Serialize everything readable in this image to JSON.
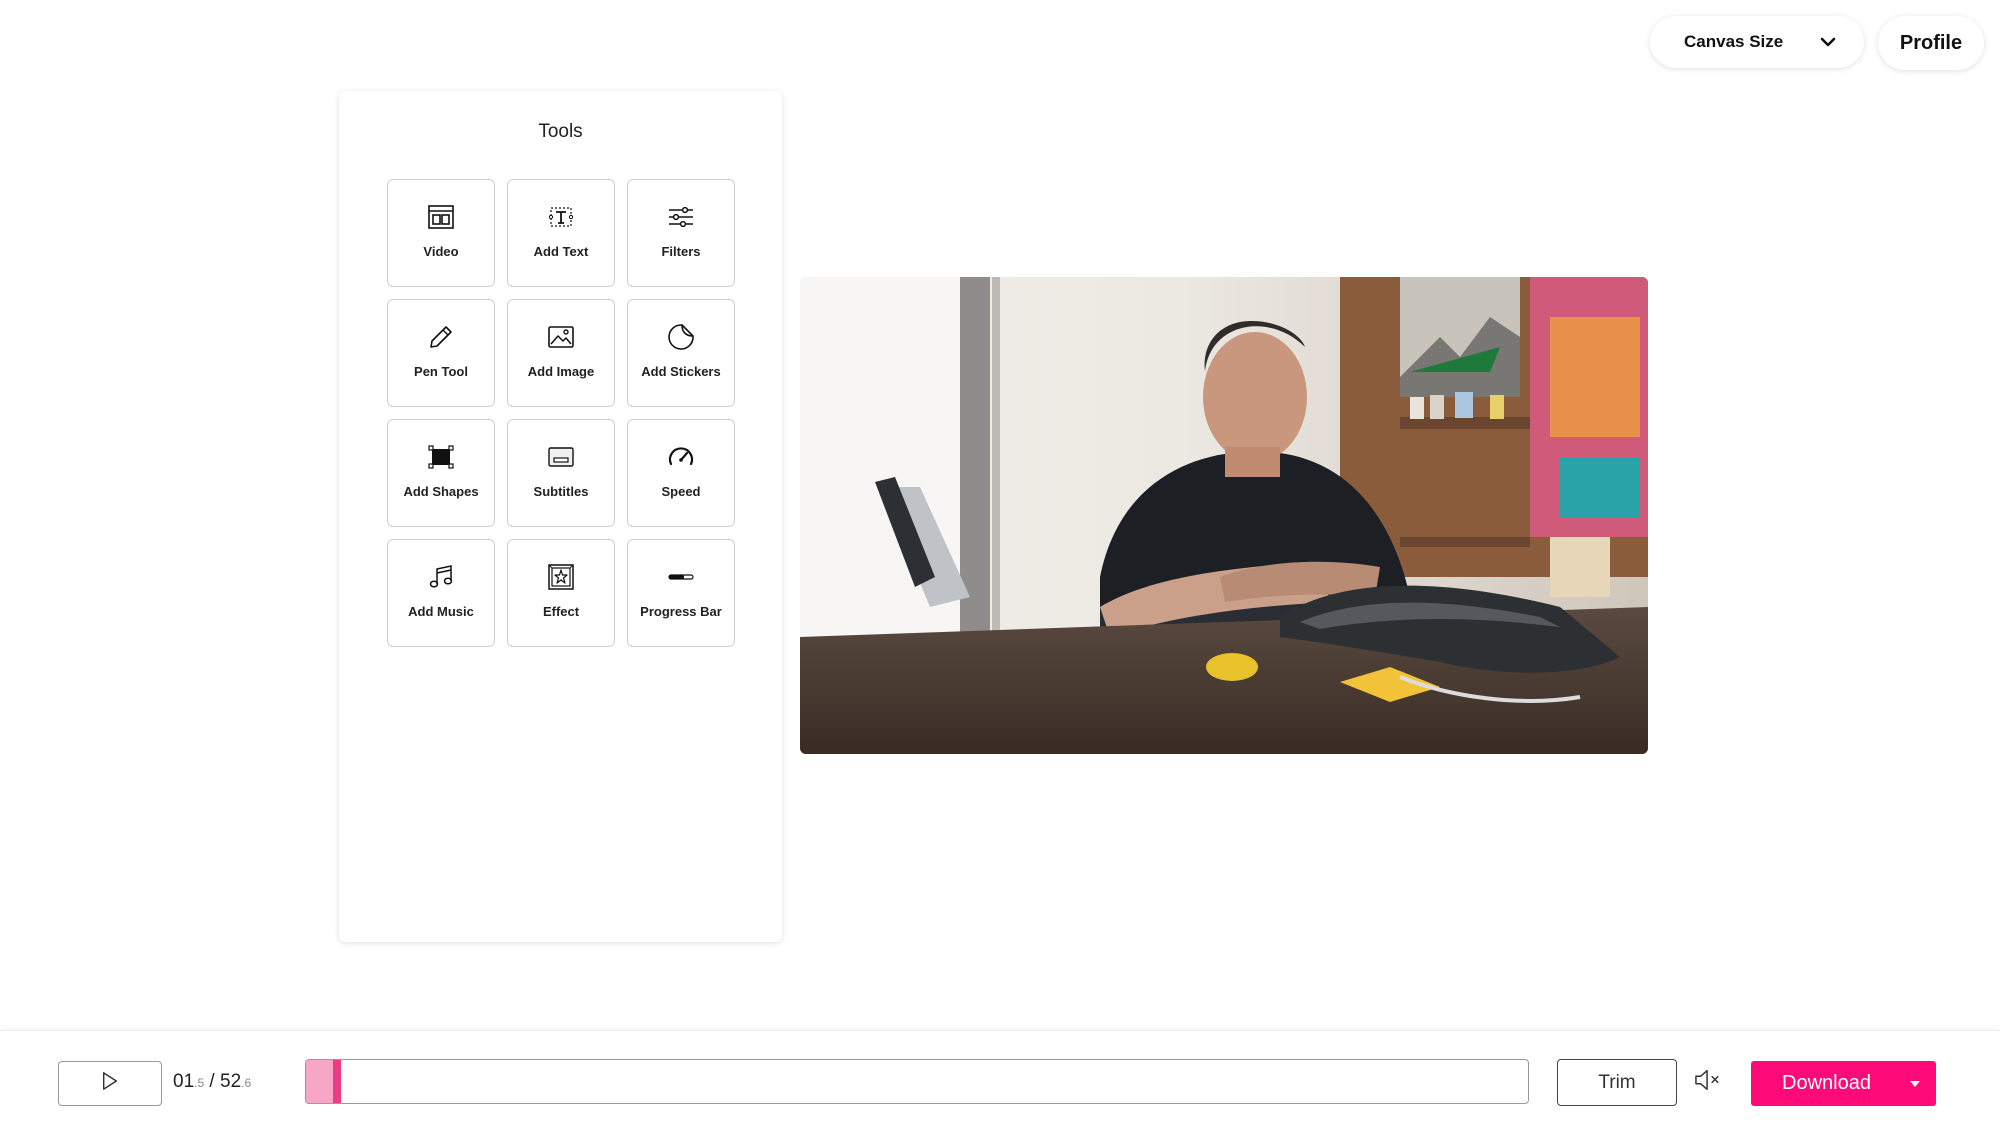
{
  "header": {
    "canvas_size_label": "Canvas Size",
    "profile_label": "Profile"
  },
  "tools": {
    "title": "Tools",
    "items": [
      {
        "label": "Video",
        "icon": "video-layout-icon"
      },
      {
        "label": "Add Text",
        "icon": "text-icon"
      },
      {
        "label": "Filters",
        "icon": "sliders-icon"
      },
      {
        "label": "Pen Tool",
        "icon": "pen-icon"
      },
      {
        "label": "Add Image",
        "icon": "image-icon"
      },
      {
        "label": "Add Stickers",
        "icon": "sticker-icon"
      },
      {
        "label": "Add Shapes",
        "icon": "shape-icon"
      },
      {
        "label": "Subtitles",
        "icon": "subtitles-icon"
      },
      {
        "label": "Speed",
        "icon": "speedometer-icon"
      },
      {
        "label": "Add Music",
        "icon": "music-note-icon"
      },
      {
        "label": "Effect",
        "icon": "effect-icon"
      },
      {
        "label": "Progress Bar",
        "icon": "progress-bar-icon"
      }
    ]
  },
  "player": {
    "current_time_main": "01",
    "current_time_frac": ".5",
    "separator": " / ",
    "total_time_main": "52",
    "total_time_frac": ".6",
    "progress_fraction": 0.029,
    "trim_label": "Trim",
    "download_label": "Download"
  },
  "colors": {
    "accent": "#ff0a78",
    "timeline_fill": "#f7a6c6",
    "timeline_handle": "#ec3c84"
  }
}
